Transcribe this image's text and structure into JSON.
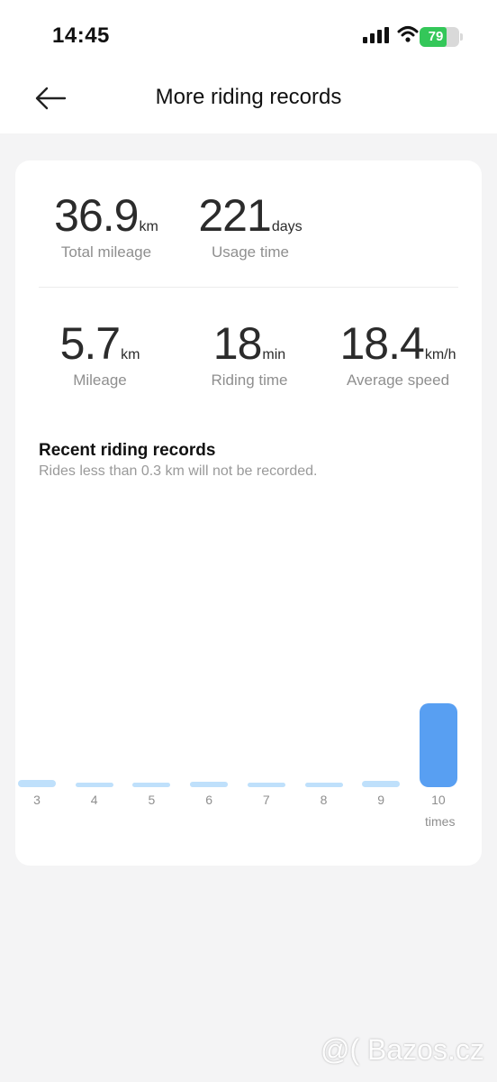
{
  "status_bar": {
    "time": "14:45",
    "battery": "79"
  },
  "header": {
    "title": "More riding records",
    "back_icon": "arrow-left-icon"
  },
  "summary": {
    "total_mileage": {
      "value": "36.9",
      "unit": "km",
      "label": "Total mileage"
    },
    "usage_time": {
      "value": "221",
      "unit": "days",
      "label": "Usage time"
    }
  },
  "latest": {
    "mileage": {
      "value": "5.7",
      "unit": "km",
      "label": "Mileage"
    },
    "riding_time": {
      "value": "18",
      "unit": "min",
      "label": "Riding time"
    },
    "average_speed": {
      "value": "18.4",
      "unit": "km/h",
      "label": "Average speed"
    }
  },
  "records": {
    "title": "Recent riding records",
    "subtitle": "Rides less than 0.3 km will not be recorded."
  },
  "chart_data": {
    "type": "bar",
    "categories": [
      "3",
      "4",
      "5",
      "6",
      "7",
      "8",
      "9",
      "10"
    ],
    "values": [
      0.5,
      0.3,
      0.25,
      0.35,
      0.1,
      0.1,
      0.45,
      5.7
    ],
    "x_unit": "times",
    "highlight_index": 7,
    "colors": {
      "bar": "#bfe0fb",
      "active": "#589ff2"
    }
  },
  "watermark": "@( Bazos.cz"
}
